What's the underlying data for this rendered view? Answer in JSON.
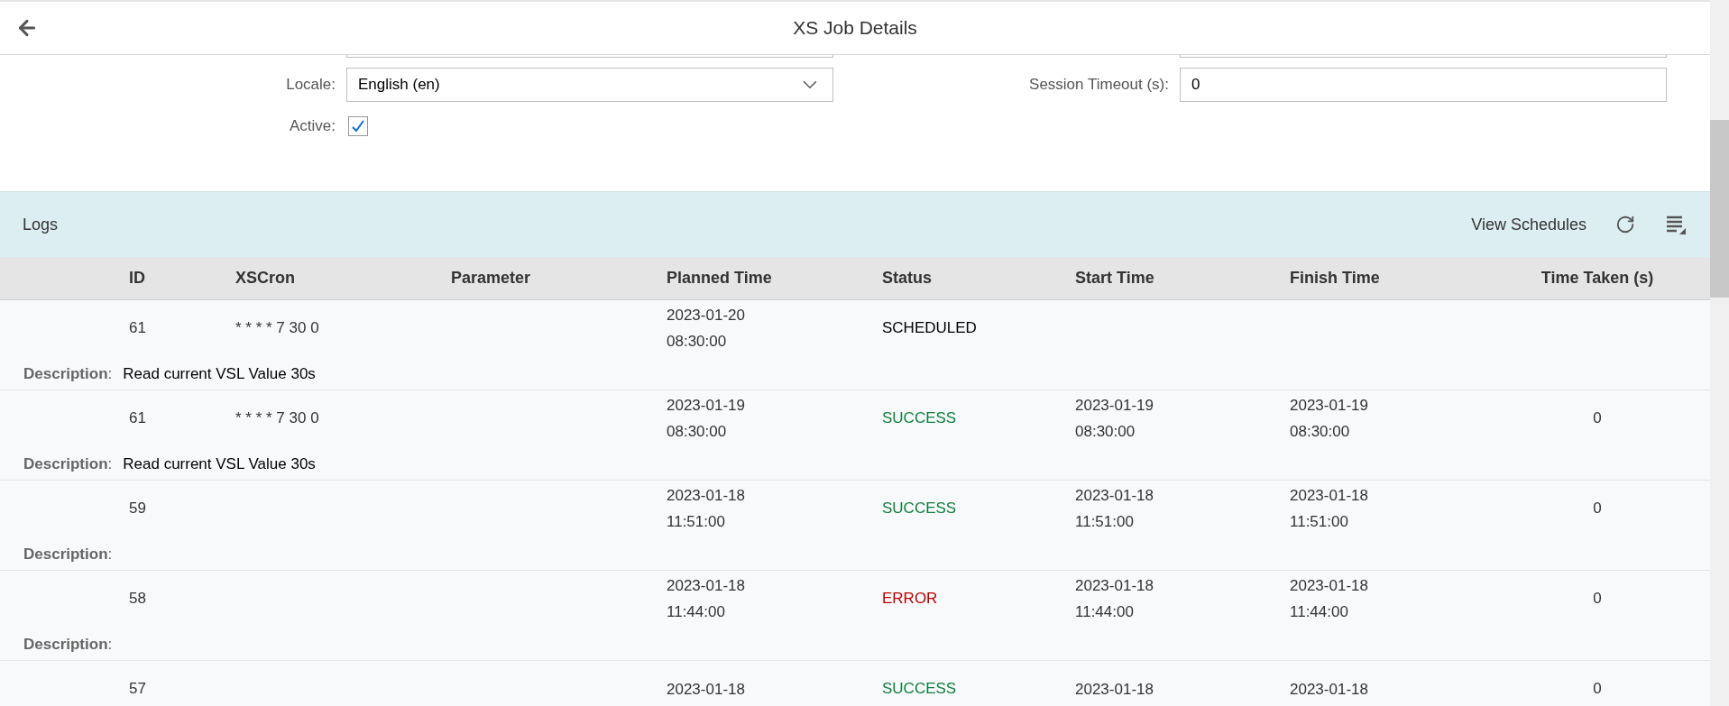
{
  "header": {
    "title": "XS Job Details"
  },
  "form": {
    "locale": {
      "label": "Locale:",
      "value": "English (en)"
    },
    "session_timeout": {
      "label": "Session Timeout (s):",
      "value": "0"
    },
    "active": {
      "label": "Active:",
      "checked": true
    }
  },
  "logs": {
    "title": "Logs",
    "view_schedules": "View Schedules",
    "columns": [
      "ID",
      "XSCron",
      "Parameter",
      "Planned Time",
      "Status",
      "Start Time",
      "Finish Time",
      "Time Taken (s)"
    ],
    "rows": [
      {
        "id": "61",
        "xscron": "* * * * 7 30 0",
        "planned_date": "2023-01-20",
        "planned_time": "08:30:00",
        "status": "SCHEDULED",
        "color": "#000000",
        "description_label": "**Description**:",
        "description": "Read current VSL Value 30s"
      },
      {
        "id": "61",
        "xscron": "* * * * 7 30 0",
        "planned_date": "2023-01-19",
        "planned_time": "08:30:00",
        "status": "SUCCESS",
        "color": "#107e3e",
        "start_date": "2023-01-19",
        "start_time": "08:30:00",
        "finish_date": "2023-01-19",
        "finish_time": "08:30:00",
        "time_taken": "0",
        "description_label": "**Description**:",
        "description": "Read current VSL Value 30s"
      },
      {
        "id": "59",
        "planned_date": "2023-01-18",
        "planned_time": "11:51:00",
        "status": "SUCCESS",
        "color": "#107e3e",
        "start_date": "2023-01-18",
        "start_time": "11:51:00",
        "finish_date": "2023-01-18",
        "finish_time": "11:51:00",
        "time_taken": "0",
        "description_label": "**Description**:"
      },
      {
        "id": "58",
        "planned_date": "2023-01-18",
        "planned_time": "11:44:00",
        "status": "ERROR",
        "color": "#bb0000",
        "start_date": "2023-01-18",
        "start_time": "11:44:00",
        "finish_date": "2023-01-18",
        "finish_time": "11:44:00",
        "time_taken": "0",
        "description_label": "**Description**:"
      },
      {
        "id": "57",
        "planned_date": "2023-01-18",
        "status": "SUCCESS",
        "color": "#107e3e",
        "start_date": "2023-01-18",
        "finish_date": "2023-01-18",
        "time_taken": "0"
      }
    ]
  }
}
